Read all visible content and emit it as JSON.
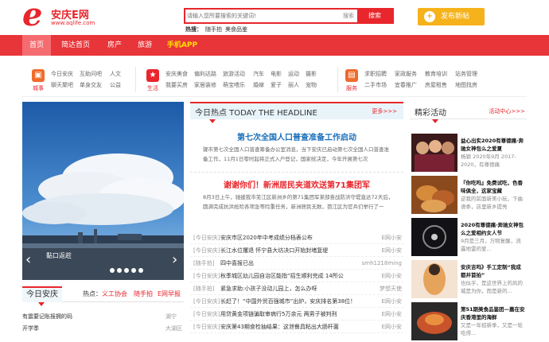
{
  "logo": {
    "text": "安庆E网",
    "url_text": "www.aqlife.com"
  },
  "search": {
    "placeholder": "请输入您所要搜索的关键词!",
    "category": "搜索",
    "button": "搜索"
  },
  "hot_search": {
    "label": "热搜：",
    "items": [
      "随手拍",
      "美食品鉴"
    ]
  },
  "post_button": "发布新帖",
  "nav": [
    "首页",
    "简达首页",
    "房产",
    "旅游",
    "手机APP"
  ],
  "categories": [
    {
      "label": "城事",
      "icon": "city-icon",
      "color": "#ef6b2c",
      "links": [
        "今日安庆",
        "互助问吧",
        "人文",
        "聊天聚吧",
        "单身交友",
        "公益"
      ]
    },
    {
      "label": "生活",
      "icon": "life-icon",
      "color": "#e8262c",
      "links": [
        "安庆美食",
        "偏利达路",
        "旅游活动",
        "汽车",
        "电影",
        "运动",
        "摄影",
        "我要买房",
        "家居装修",
        "萌宝喂乐",
        "婚嫁",
        "爱子",
        "丽人",
        "宠物"
      ]
    },
    {
      "label": "服务",
      "icon": "service-icon",
      "color": "#ef6b2c",
      "links": [
        "求职招聘",
        "家政服务",
        "教育培训",
        "站务管理",
        "二手市场",
        "宜春推广",
        "房屋租售",
        "地图找房"
      ]
    }
  ],
  "slider": {
    "caption": "黏口返趁"
  },
  "today": {
    "title": "今日安庆",
    "hot_label": "热点：",
    "hot_items": [
      "义工协会",
      "随手拍",
      "E网早报"
    ]
  },
  "today_list": [
    {
      "title": "有震要记账报拥的码",
      "right": "湖宁"
    },
    {
      "title": "开学季",
      "right": "大湖区"
    }
  ],
  "headline": {
    "bar": "今日热点 TODAY THE HEADLINE",
    "more": "更多>>>",
    "main_title": "第七次全国人口普查准备工作启动",
    "main_body": "骤市第七次全国人口普查筹备办公室消息，当下安庆已启动第七次全国人口普查准备工作，11月1日零时起将正式入户登记，国家统决定，今年开展第七次",
    "sub_title": "谢谢你们！新洲居民夹道欢送第71集团军",
    "sub_body": "8月3日上午，驰援我市芜江区新洲乡的第71集团军某部奋战防洪守堤直达72天后，圆满完成抗洪抢险各项急等险重任务，新洲居民无数，芭江区为官兵们举行了一"
  },
  "news": [
    {
      "cat": "[今日安庆]",
      "title": "安庆市区2020年中考成绩分档表公布",
      "author": "E网小安"
    },
    {
      "cat": "[今日安庆]",
      "title": "长江水位攫退 怀宁县大坊决口开始封堵复堤",
      "author": "E网小安"
    },
    {
      "cat": "[随手拍]",
      "title": "四中喜报已出",
      "author": "smh1218ming"
    },
    {
      "cat": "[今日安庆]",
      "title": "秋季城区幼儿园自治区能指“招生顺利完成 14所公",
      "author": "E网小安"
    },
    {
      "cat": "[随手拍]",
      "title": "紧急求助:小孩子没动儿园上，怎么办呀",
      "author": "梦想天使"
    },
    {
      "cat": "[今日安庆]",
      "title": "长赶了！“中国外贸百强城市”出炉，安庆排名第38位！",
      "author": "E网小安"
    },
    {
      "cat": "[今日安庆]",
      "title": "用贷黄金项链骗取审病行5万余元 两男子被判刑",
      "author": "E网小安"
    },
    {
      "cat": "[今日安庆]",
      "title": "安庆第43期食检抽结果：这泄餐具粘出大肠杆菌",
      "author": "E网小安"
    }
  ],
  "events": {
    "title": "精彩活动",
    "more": "活动中心>>>",
    "items": [
      {
        "title": "益心出实2020有尊德痛·奔驰女神包么之爱夏",
        "sub": "杨颖 2020年9月 2017-2020，有尊德痛"
      },
      {
        "title": "『你吃吗』免费试吃，色香味俱全，这家宝藏",
        "sub": "逆我的前面新美小玩，下曲语季，店里新乡提亮"
      },
      {
        "title": "2020有尊德痛·奔驰女神包么之爱相约女人节",
        "sub": "9月是三月，万物复醒，流露地雷的爱..."
      },
      {
        "title": "安庆吉吗》手工定制“我成都并首拍”",
        "sub": "也似乎，是这世界上的风的城是为你，而是新的..."
      },
      {
        "title": "第51期美食品鉴团—嘉在安庆香港里的海鲜",
        "sub": "又是一年招新季，又是一轮吃得..."
      }
    ]
  },
  "colors": {
    "brand": "#e8262c",
    "nav": "#e8353a",
    "post": "#f5b21a",
    "headline_blue": "#1b6fb9"
  }
}
